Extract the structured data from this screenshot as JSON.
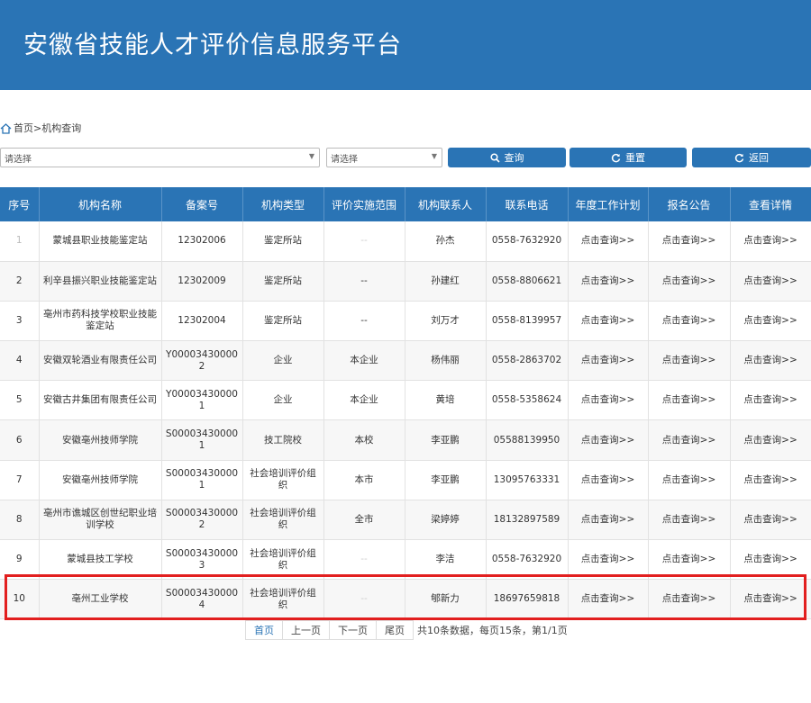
{
  "header": {
    "title": "安徽省技能人才评价信息服务平台"
  },
  "breadcrumb": {
    "text": "首页>机构查询"
  },
  "filters": {
    "select1": "请选择",
    "select2": "请选择",
    "query_label": "查询",
    "reset_label": "重置",
    "back_label": "返回"
  },
  "table": {
    "headers": [
      "序号",
      "机构名称",
      "备案号",
      "机构类型",
      "评价实施范围",
      "机构联系人",
      "联系电话",
      "年度工作计划",
      "报名公告",
      "查看详情"
    ],
    "link_text": "点击查询>>",
    "rows": [
      [
        "1",
        "蒙城县职业技能鉴定站",
        "12302006",
        "鉴定所站",
        "--",
        "孙杰",
        "0558-7632920"
      ],
      [
        "2",
        "利辛县振兴职业技能鉴定站",
        "12302009",
        "鉴定所站",
        "--",
        "孙建红",
        "0558-8806621"
      ],
      [
        "3",
        "亳州市药科技学校职业技能鉴定站",
        "12302004",
        "鉴定所站",
        "--",
        "刘万才",
        "0558-8139957"
      ],
      [
        "4",
        "安徽双轮酒业有限责任公司",
        "Y000034300002",
        "企业",
        "本企业",
        "杨伟丽",
        "0558-2863702"
      ],
      [
        "5",
        "安徽古井集团有限责任公司",
        "Y000034300001",
        "企业",
        "本企业",
        "黄培",
        "0558-5358624"
      ],
      [
        "6",
        "安徽亳州技师学院",
        "S000034300001",
        "技工院校",
        "本校",
        "李亚鹏",
        "05588139950"
      ],
      [
        "7",
        "安徽亳州技师学院",
        "S000034300001",
        "社会培训评价组织",
        "本市",
        "李亚鹏",
        "13095763331"
      ],
      [
        "8",
        "亳州市谯城区创世纪职业培训学校",
        "S000034300002",
        "社会培训评价组织",
        "全市",
        "梁婷婷",
        "18132897589"
      ],
      [
        "9",
        "蒙城县技工学校",
        "S000034300003",
        "社会培训评价组织",
        "--",
        "李洁",
        "0558-7632920"
      ],
      [
        "10",
        "亳州工业学校",
        "S000034300004",
        "社会培训评价组织",
        "--",
        "郇新力",
        "18697659818"
      ]
    ]
  },
  "pager": {
    "first": "首页",
    "prev": "上一页",
    "next": "下一页",
    "last": "尾页",
    "info": "共10条数据，每页15条，第1/1页"
  },
  "colors": {
    "primary": "#2a74b5",
    "highlight": "#e21f1f"
  },
  "icons": {
    "home": "home-icon",
    "query": "search-icon",
    "reset": "refresh-icon",
    "back": "refresh-icon"
  }
}
